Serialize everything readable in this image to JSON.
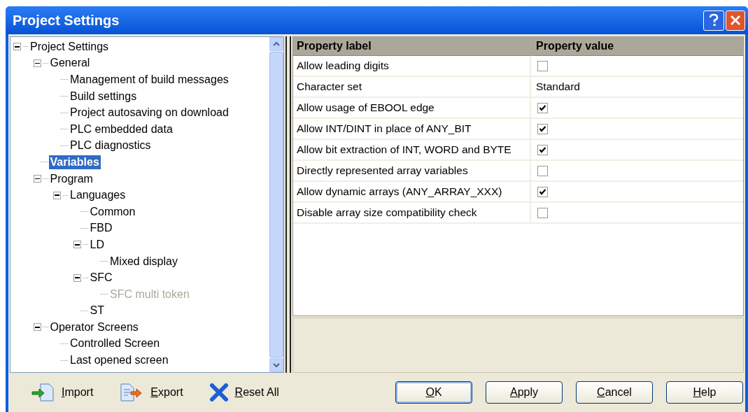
{
  "window": {
    "title": "Project Settings"
  },
  "tree": [
    {
      "label": "Project Settings",
      "expanded": true,
      "selected": false,
      "disabled": false,
      "children": [
        {
          "label": "General",
          "expanded": true,
          "selected": false,
          "disabled": false,
          "children": [
            {
              "label": "Management of build messages",
              "selected": false,
              "disabled": false
            },
            {
              "label": "Build settings",
              "selected": false,
              "disabled": false
            },
            {
              "label": "Project autosaving on download",
              "selected": false,
              "disabled": false
            },
            {
              "label": "PLC embedded data",
              "selected": false,
              "disabled": false
            },
            {
              "label": "PLC diagnostics",
              "selected": false,
              "disabled": false
            }
          ]
        },
        {
          "label": "Variables",
          "selected": true,
          "disabled": false
        },
        {
          "label": "Program",
          "expanded": true,
          "selected": false,
          "disabled": false,
          "children": [
            {
              "label": "Languages",
              "expanded": true,
              "selected": false,
              "disabled": false,
              "children": [
                {
                  "label": "Common",
                  "selected": false,
                  "disabled": false
                },
                {
                  "label": "FBD",
                  "selected": false,
                  "disabled": false
                },
                {
                  "label": "LD",
                  "expanded": true,
                  "selected": false,
                  "disabled": false,
                  "children": [
                    {
                      "label": "Mixed display",
                      "selected": false,
                      "disabled": false
                    }
                  ]
                },
                {
                  "label": "SFC",
                  "expanded": true,
                  "selected": false,
                  "disabled": false,
                  "children": [
                    {
                      "label": "SFC multi token",
                      "selected": false,
                      "disabled": true
                    }
                  ]
                },
                {
                  "label": "ST",
                  "selected": false,
                  "disabled": false
                }
              ]
            }
          ]
        },
        {
          "label": "Operator Screens",
          "expanded": true,
          "selected": false,
          "disabled": false,
          "children": [
            {
              "label": "Controlled Screen",
              "selected": false,
              "disabled": false
            },
            {
              "label": "Last opened screen",
              "selected": false,
              "disabled": false
            }
          ]
        }
      ]
    }
  ],
  "table": {
    "columns": [
      "Property label",
      "Property value"
    ],
    "rows": [
      {
        "label": "Allow leading digits",
        "kind": "checkbox",
        "checked": false
      },
      {
        "label": "Character set",
        "kind": "text",
        "value": "Standard"
      },
      {
        "label": "Allow usage of EBOOL edge",
        "kind": "checkbox",
        "checked": true
      },
      {
        "label": "Allow INT/DINT in place of ANY_BIT",
        "kind": "checkbox",
        "checked": true
      },
      {
        "label": "Allow bit extraction of INT, WORD and BYTE",
        "kind": "checkbox",
        "checked": true
      },
      {
        "label": "Directly represented array variables",
        "kind": "checkbox",
        "checked": false
      },
      {
        "label": "Allow dynamic arrays (ANY_ARRAY_XXX)",
        "kind": "checkbox",
        "checked": true
      },
      {
        "label": "Disable array size compatibility check",
        "kind": "checkbox",
        "checked": false
      }
    ]
  },
  "tools": [
    {
      "label": "Import",
      "kind": "import"
    },
    {
      "label": "Export",
      "kind": "export"
    },
    {
      "label": "Reset All",
      "kind": "reset"
    }
  ],
  "buttons": [
    {
      "label": "OK",
      "default": true
    },
    {
      "label": "Apply",
      "default": false
    },
    {
      "label": "Cancel",
      "default": false
    },
    {
      "label": "Help",
      "default": false
    }
  ]
}
